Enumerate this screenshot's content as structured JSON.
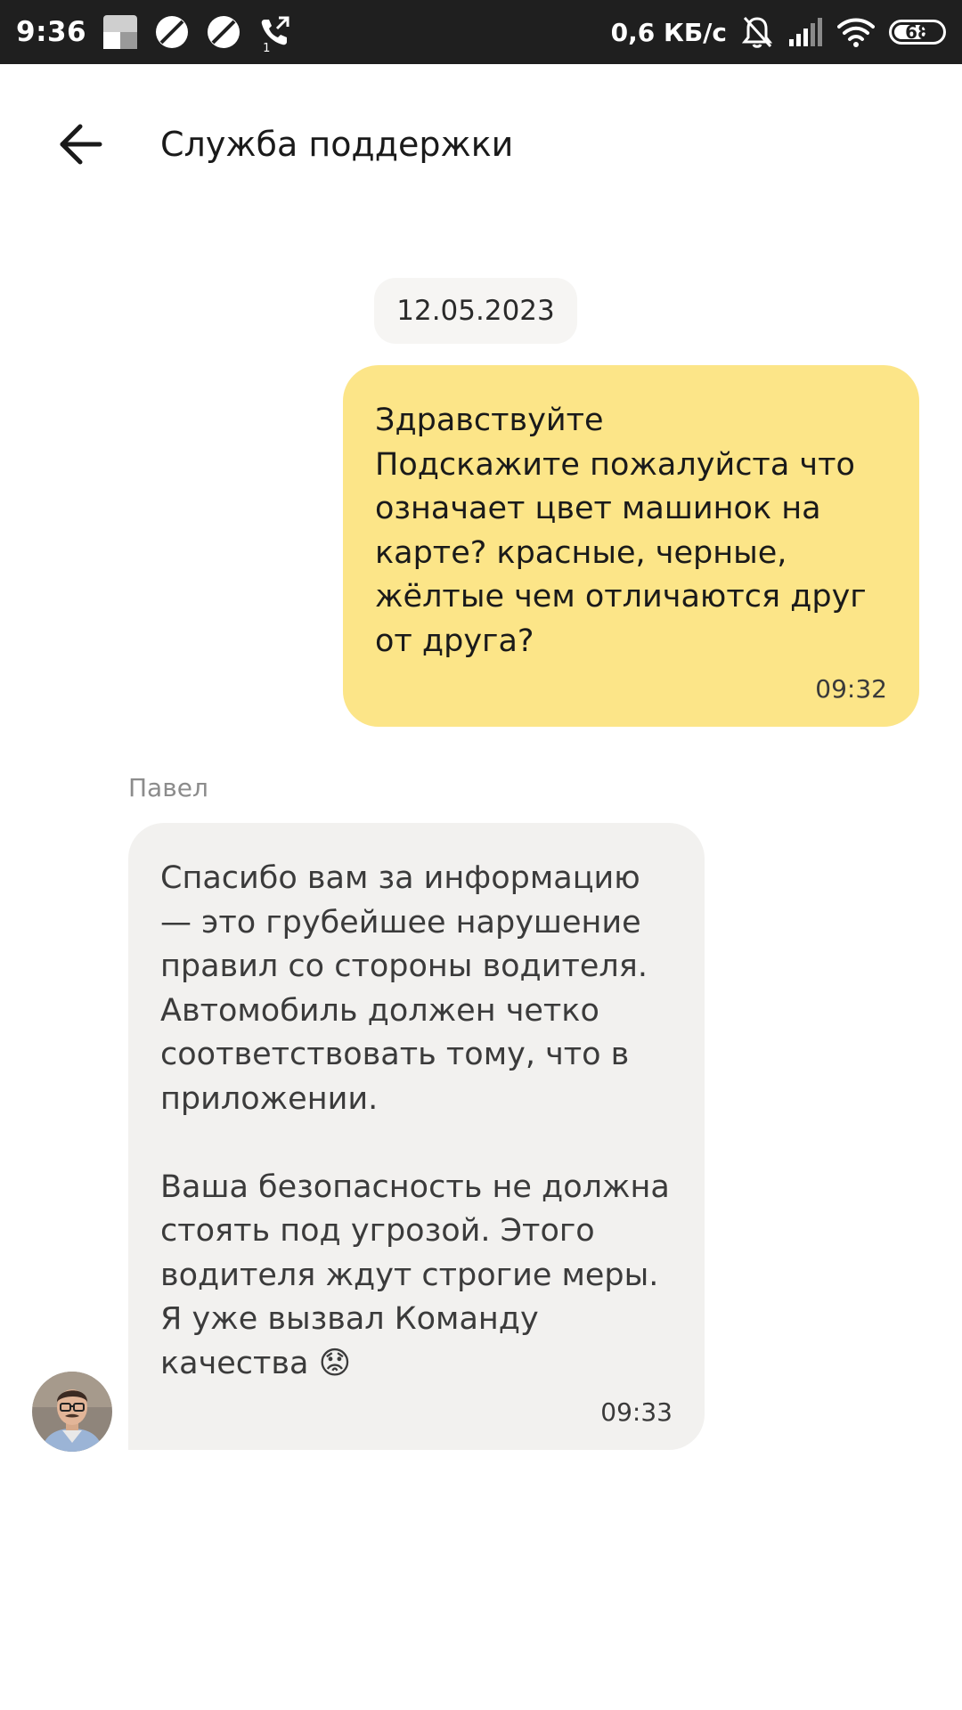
{
  "status_bar": {
    "time": "9:36",
    "net_speed": "0,6 КБ/с",
    "battery_level": "68",
    "battery_fraction": 0.68,
    "left_icons": [
      "photo-notification-icon",
      "disabled-icon",
      "disabled-icon",
      "missed-call-icon"
    ],
    "right_icons": [
      "muted-bell-icon",
      "signal-icon",
      "wifi-icon",
      "battery-icon"
    ],
    "call_count": "1"
  },
  "header": {
    "title": "Служба поддержки",
    "back_icon": "arrow-left-icon"
  },
  "chat": {
    "date": "12.05.2023",
    "messages": [
      {
        "direction": "outgoing",
        "text": "Здравствуйте\nПодскажите пожалуйста что означает цвет машинок на карте? красные, черные, жёлтые чем отличаются друг от друга?",
        "time": "09:32",
        "color": "#fce588"
      },
      {
        "direction": "incoming",
        "sender": "Павел",
        "text": "Спасибо вам за информацию — это грубейшее нарушение правил со стороны водителя. Автомобиль должен четко соответствовать тому, что в приложении.\n\nВаша безопасность не должна стоять под угрозой. Этого водителя ждут строгие меры. Я уже вызвал Команду качества 😟",
        "time": "09:33",
        "color": "#f2f1ef"
      }
    ]
  }
}
